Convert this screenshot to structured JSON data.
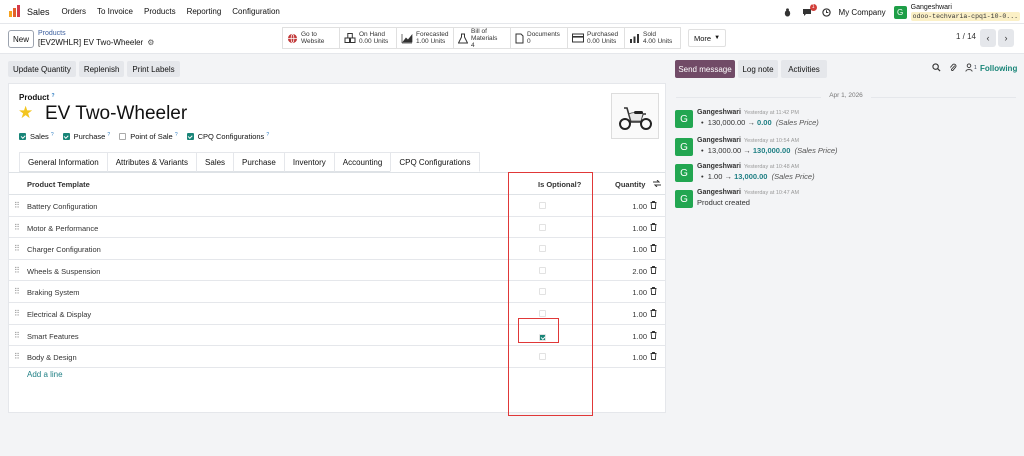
{
  "navbar": {
    "app_name": "Sales",
    "menu": [
      "Orders",
      "To Invoice",
      "Products",
      "Reporting",
      "Configuration"
    ],
    "activity_badge": "1",
    "company": "My Company",
    "user_initial": "G",
    "user_name": "Gangeshwari",
    "database": "odoo-techvaria-cpq1-10-0..."
  },
  "control_panel": {
    "new_label": "New",
    "breadcrumb_parent": "Products",
    "breadcrumb_current": "[EV2WHLR] EV Two-Wheeler",
    "smart_buttons": [
      {
        "l1": "Go to",
        "l2": "Website",
        "icon": "globe-icon"
      },
      {
        "l1": "On Hand",
        "l2": "0.00 Units",
        "icon": "boxes-icon"
      },
      {
        "l1": "Forecasted",
        "l2": "1.00 Units",
        "icon": "area-chart-icon"
      },
      {
        "l1": "Bill of Materials",
        "l2": "4",
        "icon": "flask-icon"
      },
      {
        "l1": "Documents",
        "l2": "0",
        "icon": "file-icon"
      },
      {
        "l1": "Purchased",
        "l2": "0.00 Units",
        "icon": "credit-card-icon"
      },
      {
        "l1": "Sold",
        "l2": "4.00 Units",
        "icon": "signal-icon"
      }
    ],
    "more_label": "More",
    "pager": "1 / 14"
  },
  "actions": [
    "Update Quantity",
    "Replenish",
    "Print Labels"
  ],
  "product": {
    "label": "Product",
    "name": "EV Two-Wheeler",
    "checks": [
      {
        "label": "Sales",
        "checked": true
      },
      {
        "label": "Purchase",
        "checked": true
      },
      {
        "label": "Point of Sale",
        "checked": false
      },
      {
        "label": "CPQ Configurations",
        "checked": true
      }
    ]
  },
  "tabs": [
    "General Information",
    "Attributes & Variants",
    "Sales",
    "Purchase",
    "Inventory",
    "Accounting",
    "CPQ Configurations"
  ],
  "active_tab": "CPQ Configurations",
  "table": {
    "headers": {
      "template": "Product Template",
      "optional": "Is Optional?",
      "quantity": "Quantity"
    },
    "rows": [
      {
        "name": "Battery Configuration",
        "optional": false,
        "qty": "1.00"
      },
      {
        "name": "Motor & Performance",
        "optional": false,
        "qty": "1.00"
      },
      {
        "name": "Charger Configuration",
        "optional": false,
        "qty": "1.00"
      },
      {
        "name": "Wheels & Suspension",
        "optional": false,
        "qty": "2.00"
      },
      {
        "name": "Braking System",
        "optional": false,
        "qty": "1.00"
      },
      {
        "name": "Electrical & Display",
        "optional": false,
        "qty": "1.00"
      },
      {
        "name": "Smart Features",
        "optional": true,
        "qty": "1.00"
      },
      {
        "name": "Body & Design",
        "optional": false,
        "qty": "1.00"
      }
    ],
    "add_line": "Add a line"
  },
  "chatter": {
    "send_message": "Send message",
    "log_note": "Log note",
    "activities": "Activities",
    "following": "Following",
    "followers_count": "1",
    "date_separator": "Apr 1, 2026",
    "messages": [
      {
        "author": "Gangeshwari",
        "time": "Yesterday at 11:42 PM",
        "old": "130,000.00",
        "new": "0.00",
        "field": "(Sales Price)"
      },
      {
        "author": "Gangeshwari",
        "time": "Yesterday at 10:54 AM",
        "old": "13,000.00",
        "new": "130,000.00",
        "field": "(Sales Price)"
      },
      {
        "author": "Gangeshwari",
        "time": "Yesterday at 10:48 AM",
        "old": "1.00",
        "new": "13,000.00",
        "field": "(Sales Price)"
      },
      {
        "author": "Gangeshwari",
        "time": "Yesterday at 10:47 AM",
        "text": "Product created"
      }
    ]
  },
  "colors": {
    "brand": "#714b67",
    "teal": "#198578",
    "highlight_box": "#e03838"
  }
}
